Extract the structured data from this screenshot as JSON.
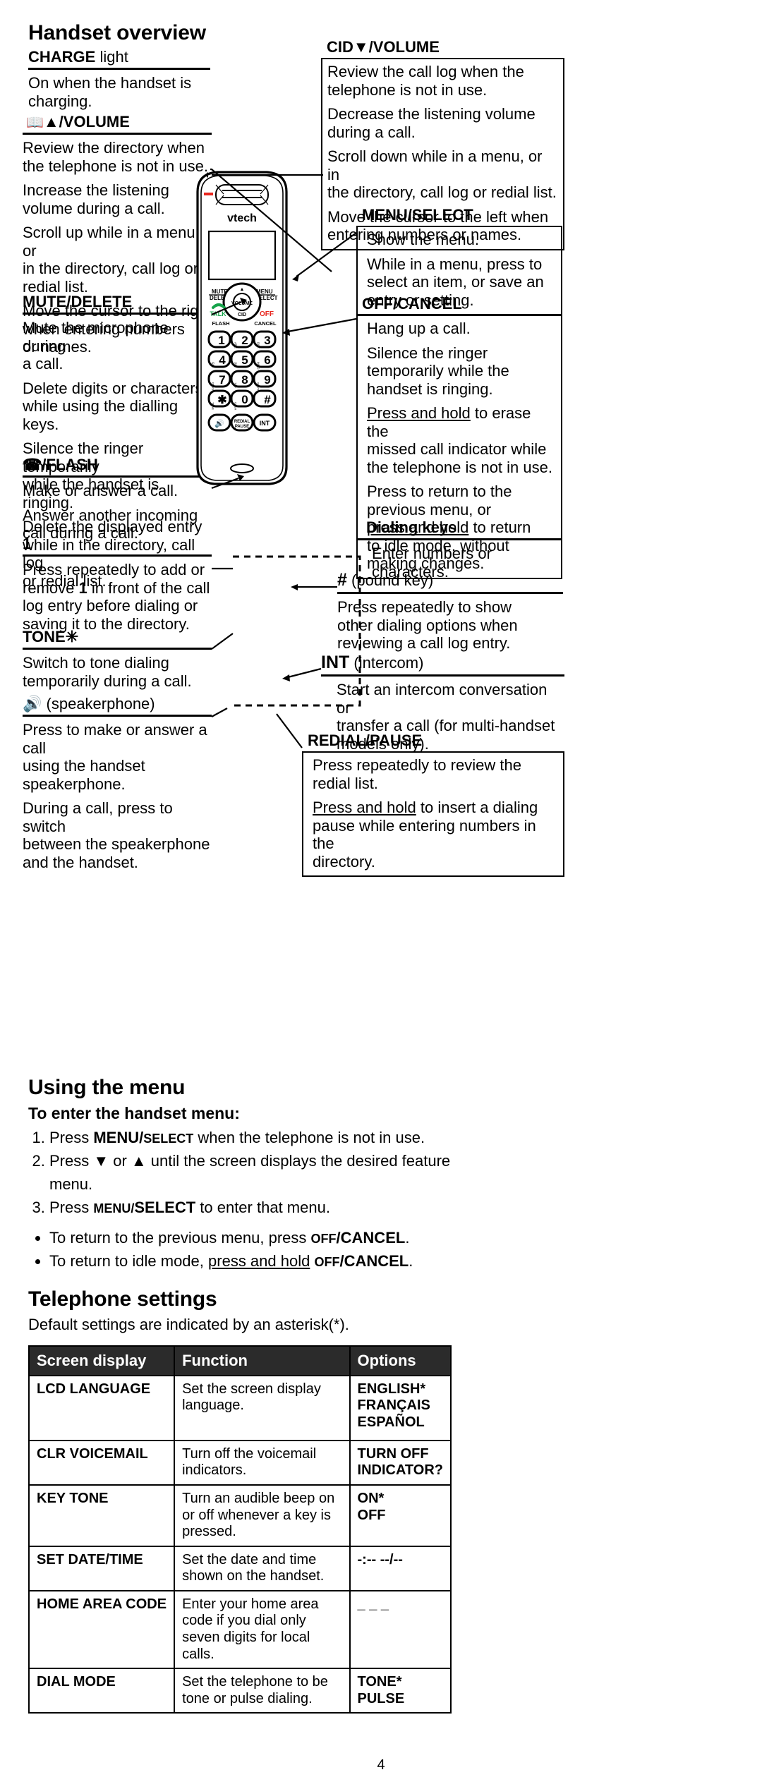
{
  "page": {
    "title": "Handset overview",
    "page_number": "4"
  },
  "callouts": {
    "charge": {
      "label_bold": "CHARGE",
      "label_rest": " light",
      "lines": [
        "On when the handset is charging."
      ]
    },
    "dir_up_volume": {
      "label": "⤴▲/VOLUME",
      "label_icon": "directory-book-icon",
      "label_text": "▲/VOLUME",
      "lines": [
        "Review the directory when\nthe telephone is not in use.",
        "Increase the listening\nvolume during a call.",
        "Scroll up while in a menu, or\nin the directory, call log or\nredial list.",
        "Move the cursor to the right\nwhen entering numbers\nor names."
      ]
    },
    "mute_delete": {
      "label": "MUTE/DELETE",
      "lines": [
        "Mute the microphone during\na call.",
        "Delete digits or characters\nwhile using the dialling keys.",
        "Silence the ringer temporarily\nwhile the handset is ringing.",
        "Delete the displayed entry\nwhile in the directory, call log\nor redial list."
      ]
    },
    "talk_flash": {
      "label_icon": "talk-handset-icon",
      "label_text": "/FLASH",
      "lines": [
        "Make or answer a call.",
        "Answer another incoming\ncall during a call."
      ]
    },
    "one_key": {
      "label": "1",
      "lines_rich": [
        {
          "pre": "Press repeatedly to add or\nremove ",
          "bold": "1",
          "post": " in front of the call\nlog entry before dialing or\nsaving it to the directory."
        }
      ]
    },
    "tone_star": {
      "label_text": "TONE",
      "label_icon": "star-key-icon",
      "lines": [
        "Switch to tone dialing\ntemporarily during a call."
      ]
    },
    "speakerphone": {
      "label_icon": "speaker-icon",
      "label_text": " (speakerphone)",
      "lines": [
        "Press to make or answer a call\nusing the handset speakerphone.",
        "During a call, press to switch\nbetween the speakerphone\nand the handset."
      ]
    },
    "cid_down_volume": {
      "label": "CID▼/VOLUME",
      "lines": [
        "Review the call log when the\ntelephone is not in use.",
        "Decrease the listening volume\nduring a call.",
        "Scroll down while in a menu, or in\nthe directory, call log or redial list.",
        "Move the cursor to the left when\nentering numbers or names."
      ]
    },
    "menu_select": {
      "label": "MENU/SELECT",
      "lines": [
        "Show the menu.",
        "While in a menu, press to\nselect an item, or save an\nentry or setting."
      ]
    },
    "off_cancel": {
      "label": "OFF/CANCEL",
      "lines": [
        "Hang up a call.",
        "Silence the ringer\ntemporarily while the\nhandset is ringing."
      ],
      "rich": [
        {
          "ul": "Press and hold",
          "rest": " to erase the\nmissed call indicator while\nthe telephone is not in use."
        },
        {
          "pre": "Press to return to the\nprevious menu, or\n",
          "ul": "press and hold",
          "rest": " to return\nto idle mode, without\nmaking changes."
        }
      ]
    },
    "dialing_keys": {
      "label": "Dialing keys",
      "lines": [
        "Enter numbers or characters."
      ]
    },
    "pound_key": {
      "label_bold": "#",
      "label_rest": " (pound key)",
      "lines": [
        "Press repeatedly to show\nother dialing options when\nreviewing a call log entry."
      ]
    },
    "int_key": {
      "label_bold": "INT",
      "label_rest": " (intercom)",
      "lines": [
        "Start an intercom conversation or\ntransfer a  call (for multi-handset\nmodels only)."
      ]
    },
    "redial_pause": {
      "label": "REDIAL/PAUSE",
      "lines": [
        "Press repeatedly to review the\nredial list."
      ],
      "rich": [
        {
          "ul": "Press and hold",
          "rest": " to insert a dialing\npause while entering numbers in the\ndirectory."
        }
      ]
    }
  },
  "phone": {
    "brand": "vtech",
    "soft_left": "MUTE\nDELETE",
    "soft_left_1": "MUTE",
    "soft_left_2": "DELETE",
    "soft_right_1": "MENU",
    "soft_right_2": "SELECT",
    "nav_top": "⤴▲",
    "nav_center": "VOLUME",
    "nav_bottom": "CID",
    "talk": "TALK",
    "flash": "FLASH",
    "off": "OFF",
    "cancel": "CANCEL",
    "keys": [
      {
        "digit": "1",
        "letters": ""
      },
      {
        "digit": "2",
        "letters": "ABC"
      },
      {
        "digit": "3",
        "letters": "DEF"
      },
      {
        "digit": "4",
        "letters": "GHI"
      },
      {
        "digit": "5",
        "letters": "JKL"
      },
      {
        "digit": "6",
        "letters": "MNO"
      },
      {
        "digit": "7",
        "letters": "PQRS"
      },
      {
        "digit": "8",
        "letters": "TUV"
      },
      {
        "digit": "9",
        "letters": "WXYZ"
      },
      {
        "digit": "✳",
        "letters": "TONE"
      },
      {
        "digit": "0",
        "letters": "OPER"
      },
      {
        "digit": "#",
        "letters": ""
      }
    ],
    "bottom_keys": [
      {
        "name": "speakerphone-key",
        "label": "◂))"
      },
      {
        "name": "redial-pause-key",
        "label": "REDIAL\nPAUSE",
        "l1": "REDIAL",
        "l2": "PAUSE"
      },
      {
        "name": "int-key",
        "label": "INT"
      }
    ]
  },
  "using_menu": {
    "heading": "Using the menu",
    "subheading": "To enter the handset menu:",
    "steps": [
      {
        "pre": "Press ",
        "b1": "MENU/",
        "sc1": "SELECT",
        "post": " when the telephone is not in use."
      },
      {
        "pre": "Press ▼ or ▲ until the screen displays the desired feature menu.",
        "b1": "",
        "sc1": "",
        "post": ""
      },
      {
        "pre": "Press ",
        "sc_first": "MENU/",
        "b_second": "SELECT",
        "post": " to enter that menu."
      }
    ],
    "bullets": [
      {
        "pre": "To return to the previous menu, press ",
        "sc": "OFF",
        "b": "/CANCEL",
        "post": "."
      },
      {
        "pre": "To return to idle mode, ",
        "ul": "press and hold",
        "mid": " ",
        "sc": "OFF",
        "b": "/CANCEL",
        "post": "."
      }
    ]
  },
  "telephone_settings": {
    "heading": "Telephone settings",
    "note": "Default settings are indicated by an asterisk(*).",
    "columns": [
      "Screen display",
      "Function",
      "Options"
    ],
    "rows": [
      {
        "screen": "LCD LANGUAGE",
        "function": "Set the screen display language.",
        "options": [
          "ENGLISH*",
          "FRANÇAIS",
          "ESPAÑOL"
        ]
      },
      {
        "screen": "CLR VOICEMAIL",
        "function": "Turn off the voicemail indicators.",
        "options": [
          "TURN OFF",
          "INDICATOR?"
        ]
      },
      {
        "screen": "KEY TONE",
        "function": "Turn an audible beep on or off whenever a key is pressed.",
        "options": [
          "ON*",
          "OFF"
        ]
      },
      {
        "screen": "SET DATE/TIME",
        "function": "Set the date and time shown on the handset.",
        "options": [
          "-:-- --/--"
        ]
      },
      {
        "screen": "HOME AREA CODE",
        "function": "Enter your home area code if you dial only seven digits for local calls.",
        "options": [
          "_ _ _"
        ]
      },
      {
        "screen": "DIAL MODE",
        "function": "Set the telephone to be tone or pulse dialing.",
        "options": [
          "TONE*",
          "PULSE"
        ]
      }
    ]
  }
}
